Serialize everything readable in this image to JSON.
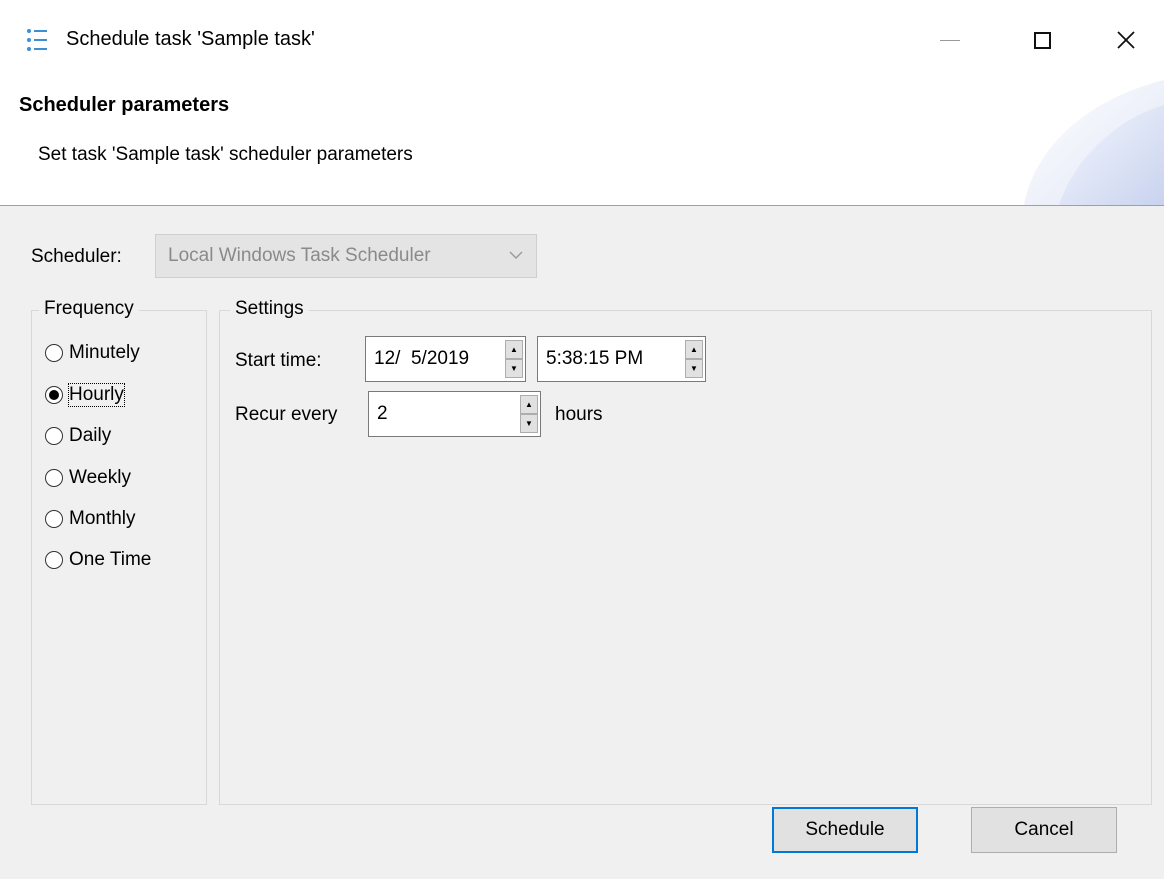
{
  "window": {
    "title": "Schedule task 'Sample task'"
  },
  "header": {
    "title": "Scheduler parameters",
    "description": "Set task 'Sample task' scheduler parameters"
  },
  "scheduler": {
    "label": "Scheduler:",
    "selected": "Local Windows Task Scheduler",
    "enabled": false
  },
  "frequency": {
    "legend": "Frequency",
    "selected": "Hourly",
    "options": [
      {
        "label": "Minutely",
        "checked": false
      },
      {
        "label": "Hourly",
        "checked": true
      },
      {
        "label": "Daily",
        "checked": false
      },
      {
        "label": "Weekly",
        "checked": false
      },
      {
        "label": "Monthly",
        "checked": false
      },
      {
        "label": "One Time",
        "checked": false
      }
    ]
  },
  "settings": {
    "legend": "Settings",
    "start_label": "Start time:",
    "start_date": "12/  5/2019",
    "start_time": "5:38:15 PM",
    "recur_label": "Recur every",
    "recur_value": "2",
    "recur_unit": "hours"
  },
  "buttons": {
    "schedule": "Schedule",
    "cancel": "Cancel"
  },
  "colors": {
    "accent": "#0078d7",
    "background": "#f0f0f0",
    "disabled_text": "#8a8a8a"
  }
}
